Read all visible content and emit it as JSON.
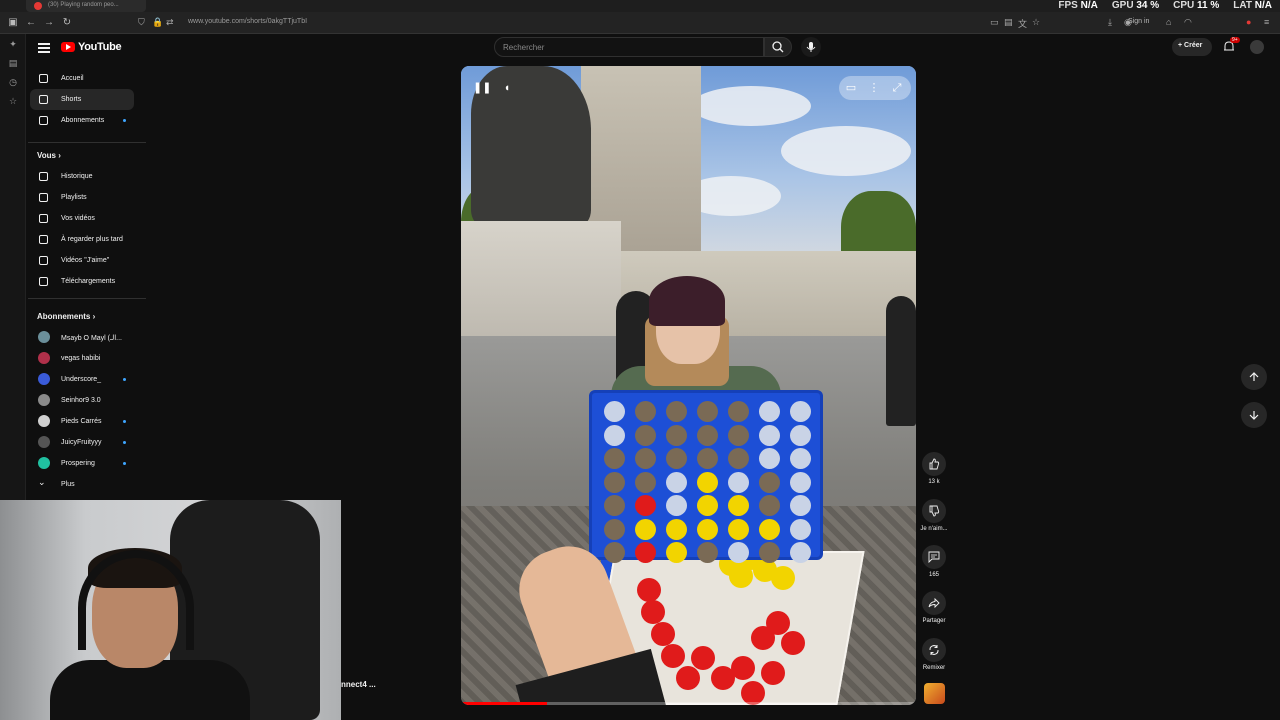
{
  "browser": {
    "tab_title": "(30) Playing random peo...",
    "url": "www.youtube.com/shorts/0akgTTjuTbI",
    "signin_label": "Sign in"
  },
  "stats": {
    "fps_label": "FPS",
    "fps_value": "N/A",
    "gpu_label": "GPU",
    "gpu_value": "34 %",
    "cpu_label": "CPU",
    "cpu_value": "11 %",
    "lat_label": "LAT",
    "lat_value": "N/A"
  },
  "header": {
    "logo_text": "YouTube",
    "search_placeholder": "Rechercher",
    "create_label": "Créer",
    "notif_count": "9+"
  },
  "sidebar": {
    "main": [
      {
        "label": "Accueil",
        "icon": "home-icon"
      },
      {
        "label": "Shorts",
        "icon": "shorts-icon",
        "active": true
      },
      {
        "label": "Abonnements",
        "icon": "subscriptions-icon",
        "new": true
      }
    ],
    "you_heading": "Vous",
    "you": [
      {
        "label": "Historique",
        "icon": "history-icon"
      },
      {
        "label": "Playlists",
        "icon": "playlists-icon"
      },
      {
        "label": "Vos vidéos",
        "icon": "your-videos-icon"
      },
      {
        "label": "À regarder plus tard",
        "icon": "watch-later-icon"
      },
      {
        "label": "Vidéos \"J'aime\"",
        "icon": "liked-videos-icon"
      },
      {
        "label": "Téléchargements",
        "icon": "downloads-icon"
      }
    ],
    "subs_heading": "Abonnements",
    "subs": [
      {
        "label": "Msayb O Mayl (الـ...",
        "color": "#6b8f9a"
      },
      {
        "label": "vegas habibi",
        "color": "#b0304a"
      },
      {
        "label": "Underscore_",
        "color": "#3a5bd9",
        "new": true
      },
      {
        "label": "Seinhor9 3.0",
        "color": "#8a8a8a"
      },
      {
        "label": "Pieds Carrés",
        "color": "#d0d0d0",
        "new": true
      },
      {
        "label": "JuicyFruityyy",
        "color": "#555555",
        "new": true
      },
      {
        "label": "Prospering",
        "color": "#20c0a0",
        "new": true
      }
    ],
    "more_label": "Plus"
  },
  "actions": {
    "likes": "13 k",
    "dislike_label": "Je n'aim...",
    "comments": "165",
    "share_label": "Partager",
    "remix_label": "Remixer"
  },
  "video": {
    "progress_pct": 19
  },
  "caption_partial": "nnect4 ..."
}
